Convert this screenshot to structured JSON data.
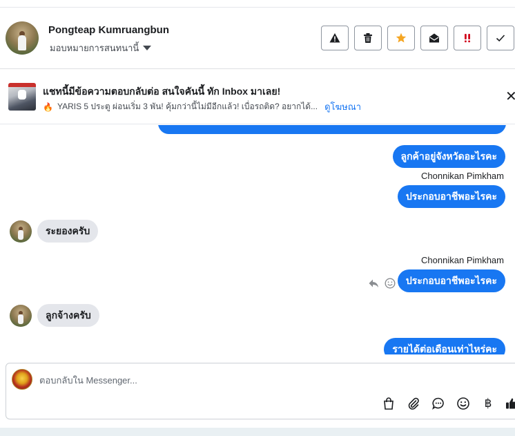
{
  "header": {
    "contact_name": "Pongteap Kumruangbun",
    "assign_label": "มอบหมายการสนทนานี้"
  },
  "toolbar": [
    {
      "icon": "warning-icon",
      "color": "#1c1e21"
    },
    {
      "icon": "trash-icon",
      "color": "#1c1e21"
    },
    {
      "icon": "star-icon",
      "color": "#f5a623"
    },
    {
      "icon": "open-envelope-icon",
      "color": "#1c1e21"
    },
    {
      "icon": "priority-exclamation-icon",
      "color": "#d0021b"
    },
    {
      "icon": "checkmark-icon",
      "color": "#1c1e21"
    }
  ],
  "ad": {
    "title": "แชทนี้มีข้อความตอบกลับต่อ สนใจคันนี้ ทัก Inbox มาเลย!",
    "subtitle": "YARIS 5 ประตู ผ่อนเริ่ม 3 พัน! คุ้มกว่านี้ไม่มีอีกแล้ว! เบื่อรถติด? อยากได้...",
    "link": "ดูโฆษณา"
  },
  "messages": [
    {
      "direction": "out",
      "text": "ลูกค้าอยู่จังหวัดอะไรคะ"
    },
    {
      "direction": "out",
      "sender": "Chonnikan Pimkham",
      "text": "ประกอบอาชีพอะไรคะ"
    },
    {
      "direction": "in",
      "text": "ระยองครับ"
    },
    {
      "direction": "out",
      "sender": "Chonnikan Pimkham",
      "text": "ประกอบอาชีพอะไรคะ"
    },
    {
      "direction": "in",
      "text": "ลูกจ้างครับ"
    },
    {
      "direction": "out",
      "text": "รายได้ต่อเดือนเท่าไหร่คะ"
    }
  ],
  "composer": {
    "placeholder": "ตอบกลับใน Messenger...",
    "currency_symbol": "฿"
  },
  "colors": {
    "brand_blue": "#1877f2",
    "incoming_bubble": "#e4e6eb"
  }
}
